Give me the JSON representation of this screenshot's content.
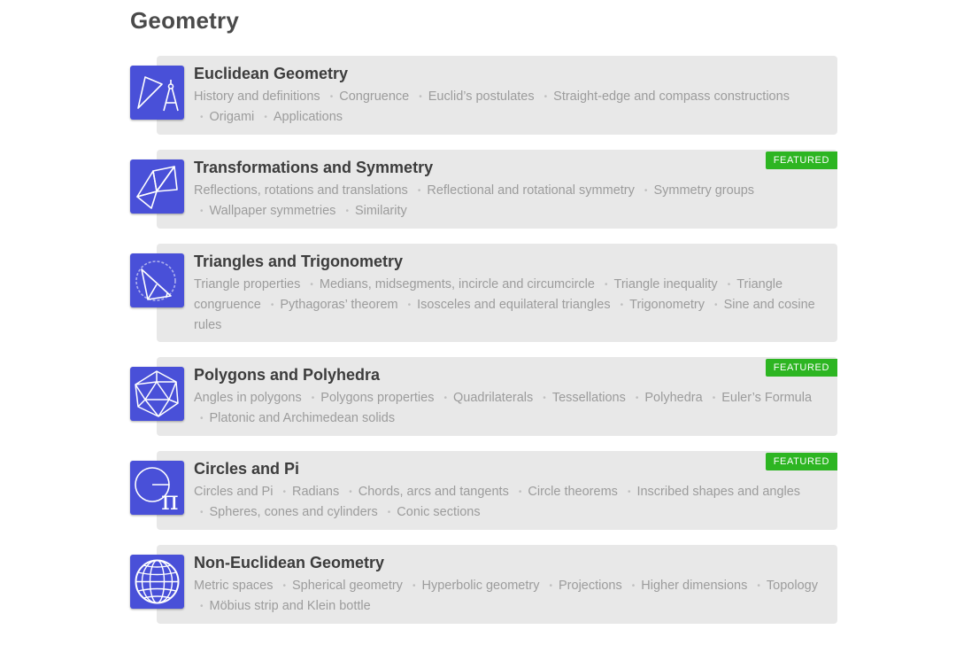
{
  "page": {
    "title": "Geometry"
  },
  "colors": {
    "icon_bg": "#4950d8",
    "card_bg": "#e8e8e8",
    "featured": "#2db522"
  },
  "courses": [
    {
      "title": "Euclidean Geometry",
      "featured": false,
      "icon": "triangle-compass-icon",
      "topics": [
        "History and definitions",
        "Congruence",
        "Euclid’s postulates",
        "Straight-edge and compass constructions",
        "Origami",
        "Applications"
      ]
    },
    {
      "title": "Transformations and Symmetry",
      "featured": true,
      "featured_label": "FEATURED",
      "icon": "reflected-triangles-icon",
      "topics": [
        "Reflections, rotations and translations",
        "Reflectional and rotational symmetry",
        "Symmetry groups",
        "Wallpaper symmetries",
        "Similarity"
      ]
    },
    {
      "title": "Triangles and Trigonometry",
      "featured": false,
      "icon": "triangle-circle-icon",
      "topics": [
        "Triangle properties",
        "Medians, midsegments, incircle and circumcircle",
        "Triangle inequality",
        "Triangle congruence",
        "Pythagoras’ theorem",
        "Isosceles and equilateral triangles",
        "Trigonometry",
        "Sine and cosine rules"
      ]
    },
    {
      "title": "Polygons and Polyhedra",
      "featured": true,
      "featured_label": "FEATURED",
      "icon": "icosahedron-icon",
      "topics": [
        "Angles in polygons",
        "Polygons properties",
        "Quadrilaterals",
        "Tessellations",
        "Polyhedra",
        "Euler’s Formula",
        "Platonic and Archimedean solids"
      ]
    },
    {
      "title": "Circles and Pi",
      "featured": true,
      "featured_label": "FEATURED",
      "icon": "circle-pi-icon",
      "icon_glyph": "π",
      "topics": [
        "Circles and Pi",
        "Radians",
        "Chords, arcs and tangents",
        "Circle theorems",
        "Inscribed shapes and angles",
        "Spheres, cones and cylinders",
        "Conic sections"
      ]
    },
    {
      "title": "Non-Euclidean Geometry",
      "featured": false,
      "icon": "globe-grid-icon",
      "topics": [
        "Metric spaces",
        "Spherical geometry",
        "Hyperbolic geometry",
        "Projections",
        "Higher dimensions",
        "Topology",
        "Möbius strip and Klein bottle"
      ]
    }
  ]
}
